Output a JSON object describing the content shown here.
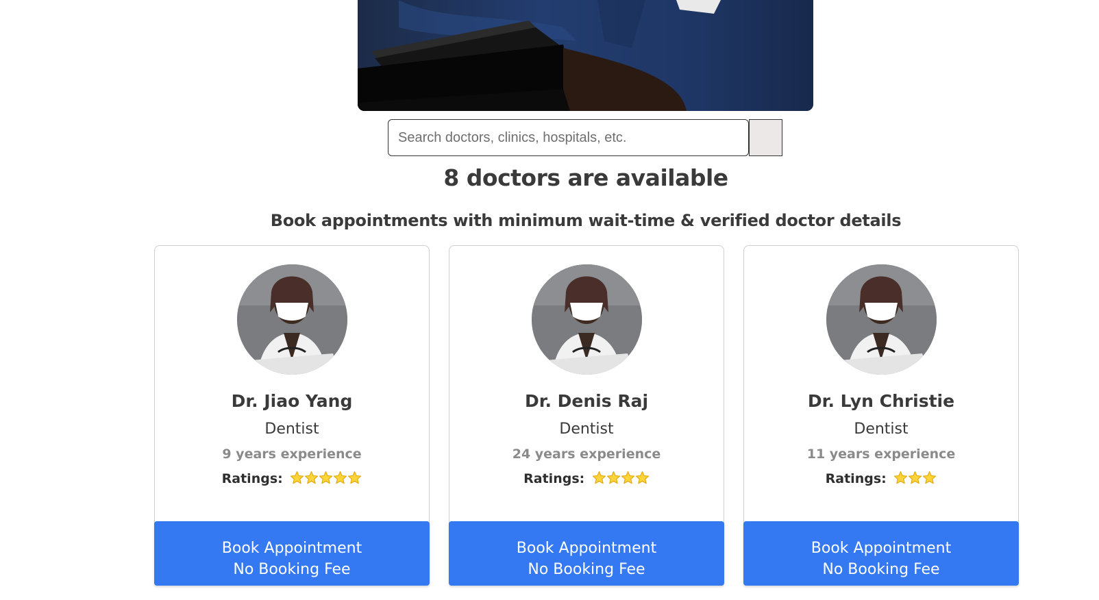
{
  "search": {
    "placeholder": "Search doctors, clinics, hospitals, etc."
  },
  "headline": "8 doctors are available",
  "subheadline": "Book appointments with minimum wait-time & verified doctor details",
  "ratings_label": "Ratings:",
  "doctors": [
    {
      "name": "Dr. Jiao Yang",
      "specialty": "Dentist",
      "experience": "9 years experience",
      "stars": 5,
      "button_line1": "Book Appointment",
      "button_line2": "No Booking Fee"
    },
    {
      "name": "Dr. Denis Raj",
      "specialty": "Dentist",
      "experience": "24 years experience",
      "stars": 4,
      "button_line1": "Book Appointment",
      "button_line2": "No Booking Fee"
    },
    {
      "name": "Dr. Lyn Christie",
      "specialty": "Dentist",
      "experience": "11 years experience",
      "stars": 3,
      "button_line1": "Book Appointment",
      "button_line2": "No Booking Fee"
    }
  ],
  "colors": {
    "button": "#3479f1",
    "star_fill": "#ffd43b",
    "star_stroke": "#e0a400"
  },
  "icons": {
    "star": "star-icon",
    "avatar": "doctor-avatar"
  }
}
